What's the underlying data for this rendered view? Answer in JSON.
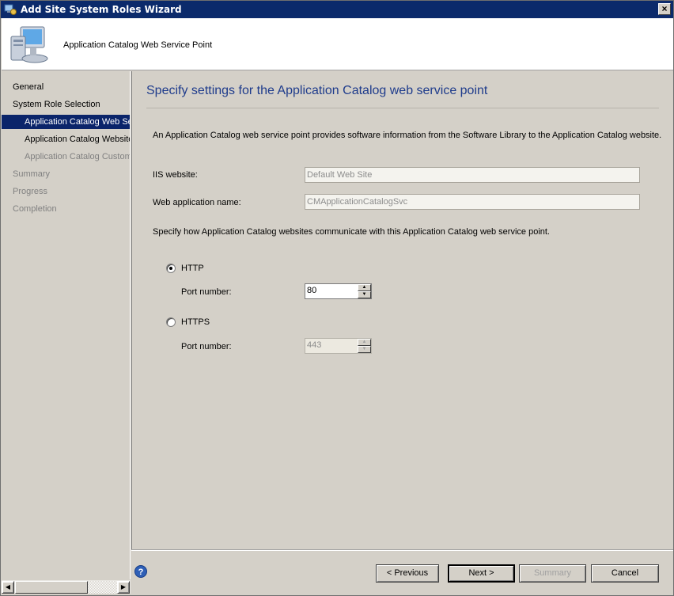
{
  "window": {
    "title": "Add Site System Roles Wizard"
  },
  "header": {
    "title": "Application Catalog Web Service Point"
  },
  "sidebar": {
    "items": [
      {
        "label": "General",
        "state": "normal"
      },
      {
        "label": "System Role Selection",
        "state": "normal"
      },
      {
        "label": "Application Catalog Web Service Point",
        "state": "selected"
      },
      {
        "label": "Application Catalog Website Point",
        "state": "normal"
      },
      {
        "label": "Application Catalog Customizations",
        "state": "disabled"
      },
      {
        "label": "Summary",
        "state": "disabled"
      },
      {
        "label": "Progress",
        "state": "disabled"
      },
      {
        "label": "Completion",
        "state": "disabled"
      }
    ]
  },
  "main": {
    "heading": "Specify settings for the Application Catalog web service point",
    "description": "An Application Catalog web service point provides software information from the Software Library to the Application Catalog website.",
    "iis_label": "IIS website:",
    "iis_value": "Default Web Site",
    "webapp_label": "Web application name:",
    "webapp_value": "CMApplicationCatalogSvc",
    "communicate_text": "Specify how Application Catalog websites communicate with this Application Catalog web service point.",
    "http_label": "HTTP",
    "http_checked": true,
    "http_port_label": "Port number:",
    "http_port": "80",
    "https_label": "HTTPS",
    "https_checked": false,
    "https_port_label": "Port number:",
    "https_port": "443"
  },
  "footer": {
    "previous": "< Previous",
    "next": "Next >",
    "summary": "Summary",
    "cancel": "Cancel"
  },
  "colors": {
    "titlebar": "#0b2a6b",
    "selection": "#0a246a",
    "heading": "#1f3c8c"
  }
}
